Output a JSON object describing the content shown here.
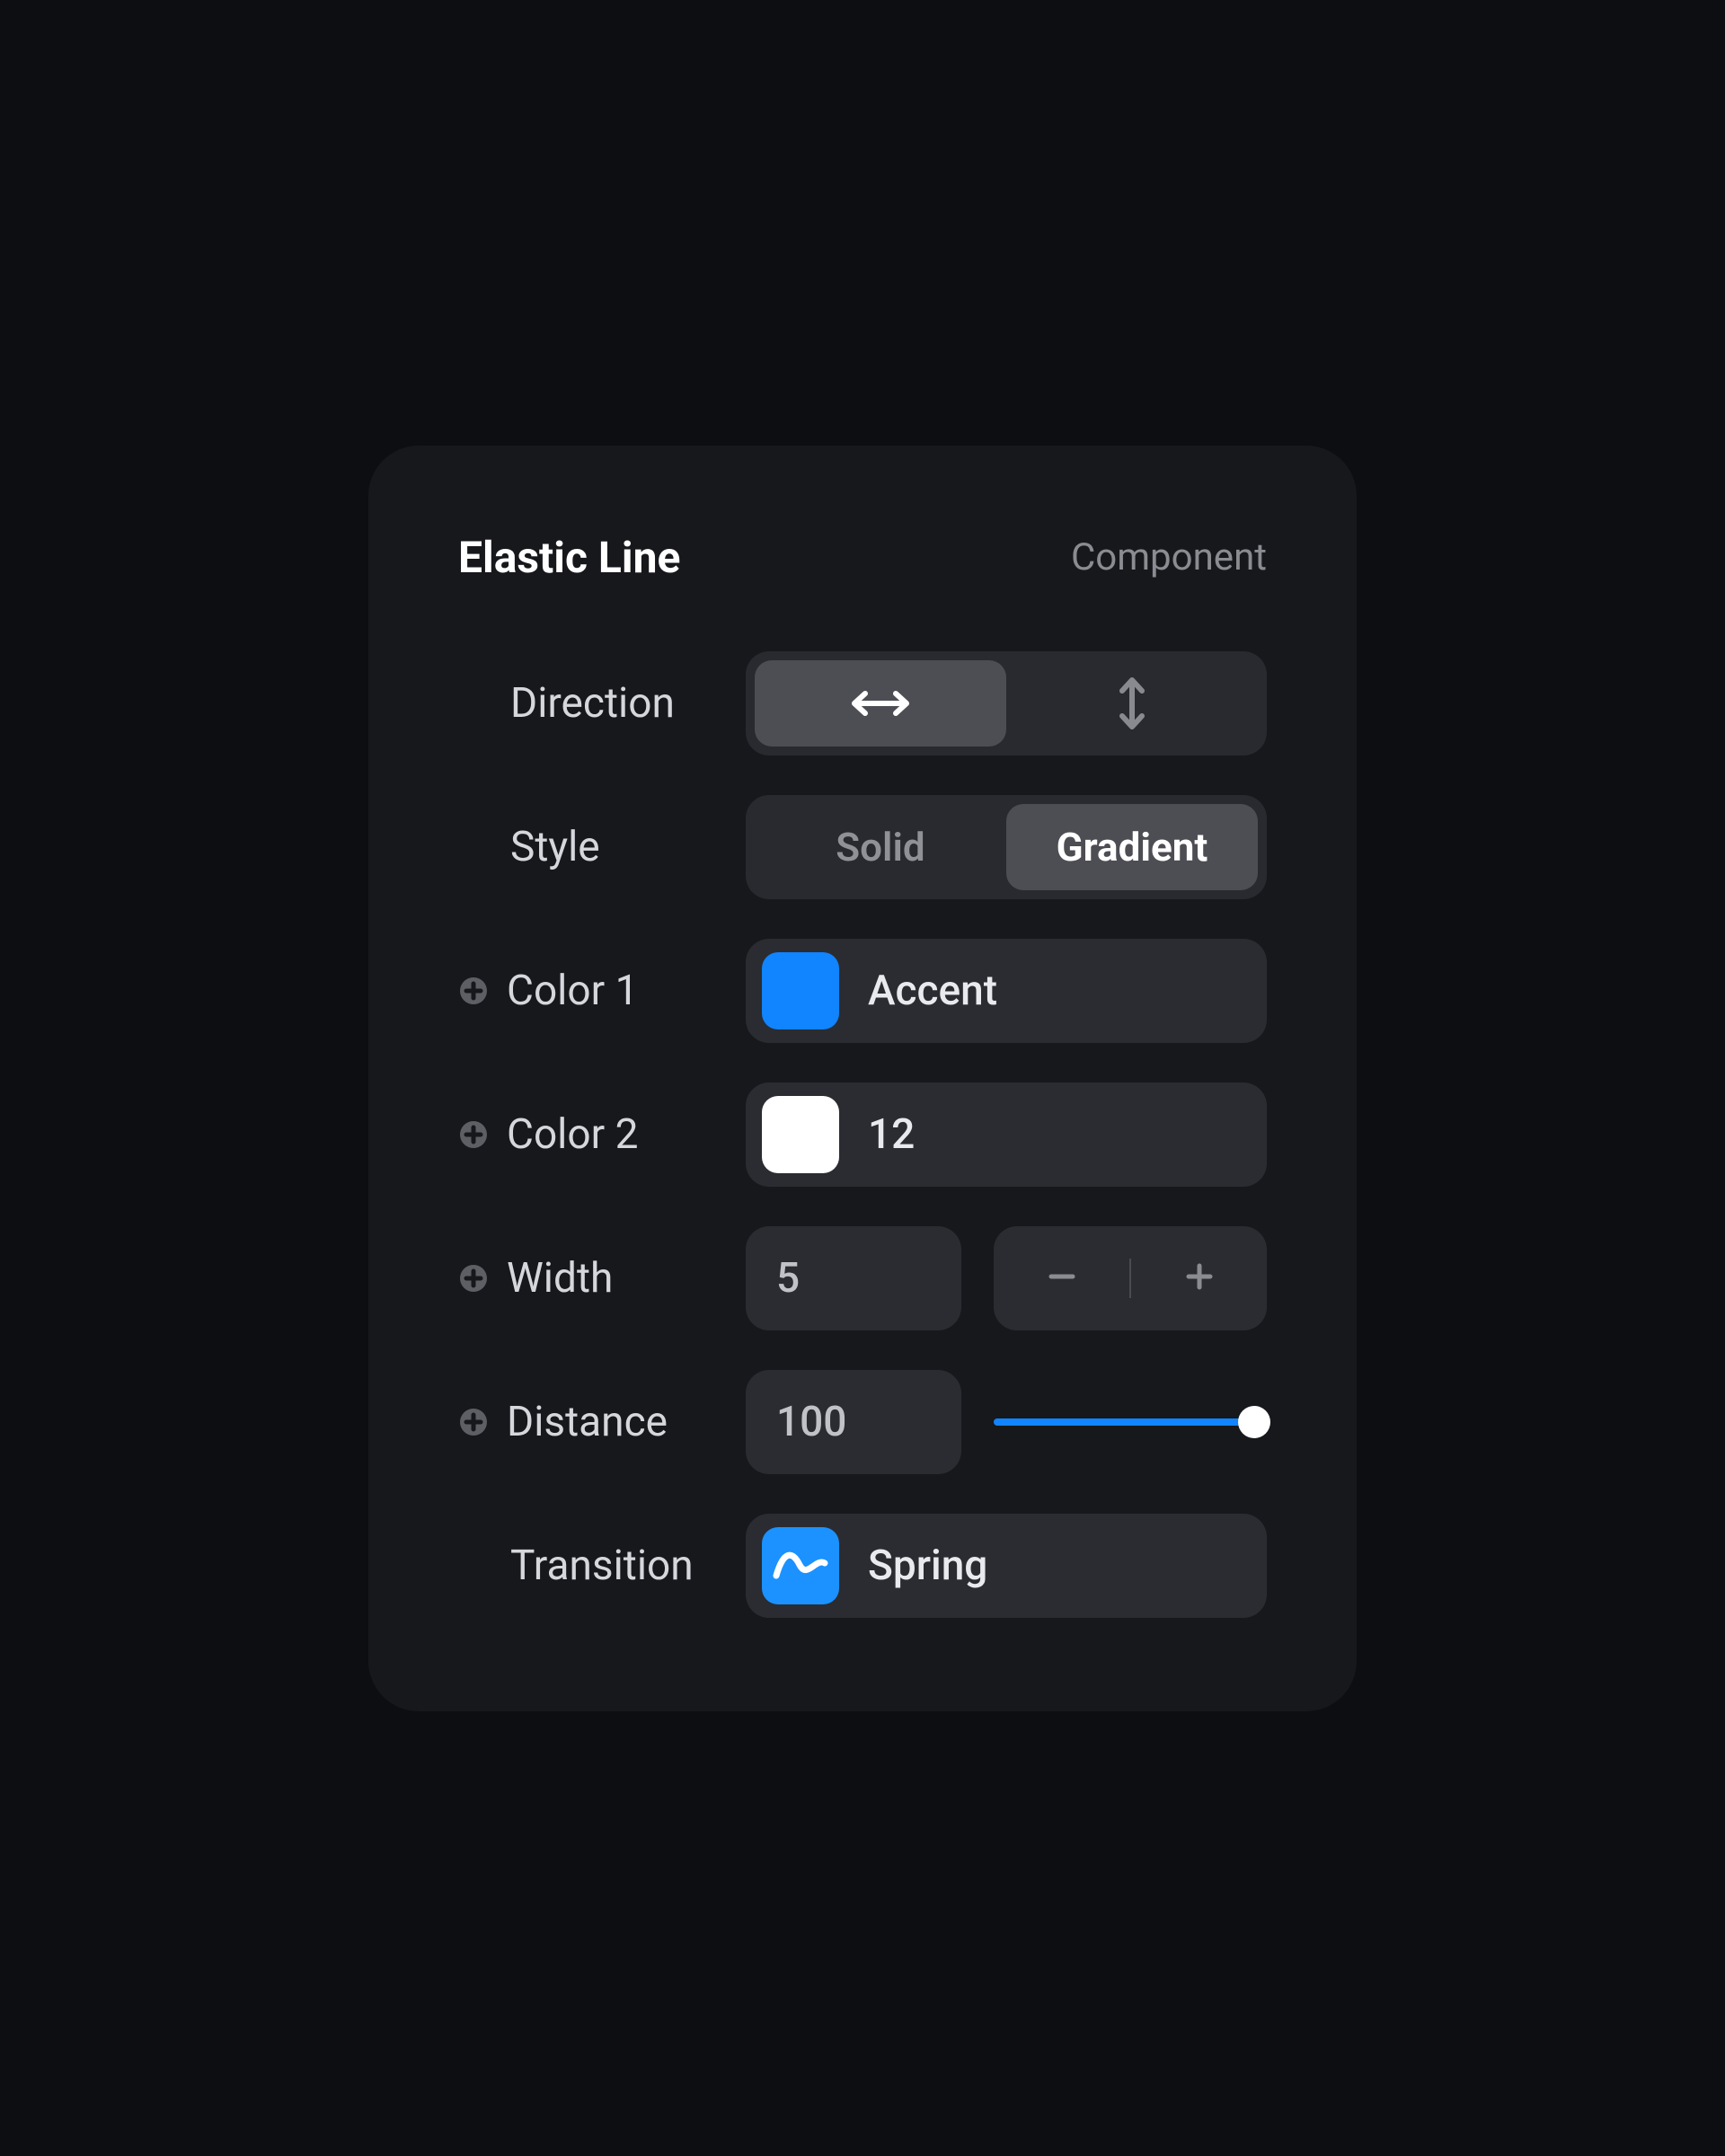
{
  "header": {
    "title": "Elastic Line",
    "subtitle": "Component"
  },
  "rows": {
    "direction": {
      "label": "Direction"
    },
    "style": {
      "label": "Style",
      "solid": "Solid",
      "gradient": "Gradient"
    },
    "color1": {
      "label": "Color 1",
      "value": "Accent",
      "hex": "#1184ff"
    },
    "color2": {
      "label": "Color 2",
      "value": "12",
      "hex": "#ffffff"
    },
    "width": {
      "label": "Width",
      "value": "5"
    },
    "distance": {
      "label": "Distance",
      "value": "100"
    },
    "transition": {
      "label": "Transition",
      "value": "Spring"
    }
  }
}
